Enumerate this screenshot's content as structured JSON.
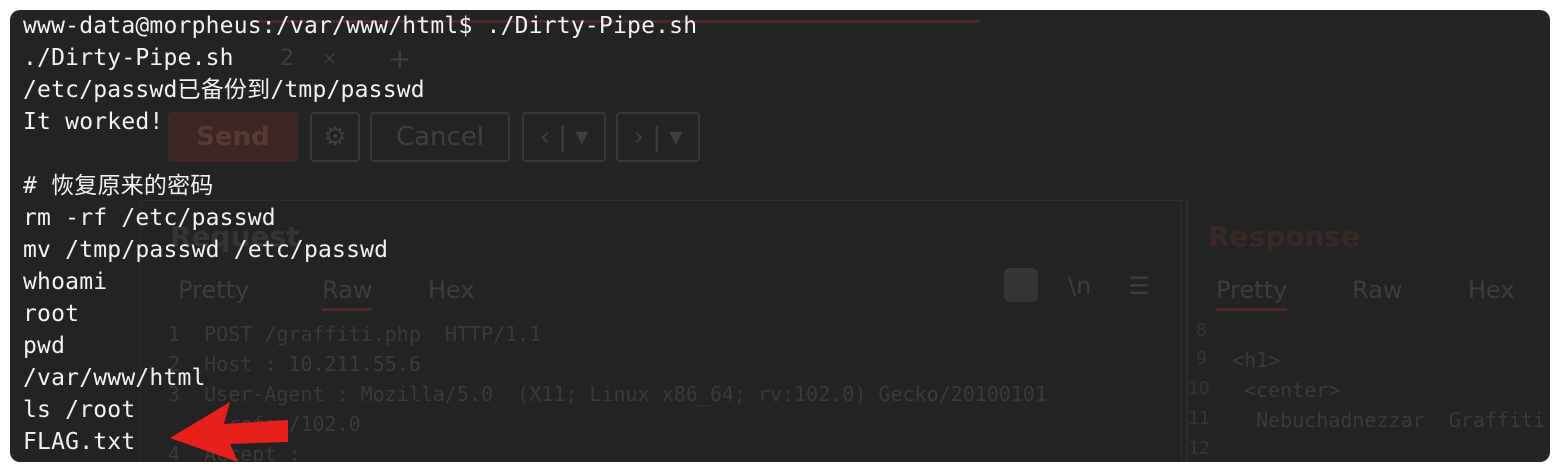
{
  "terminal": {
    "lines": [
      "www-data@morpheus:/var/www/html$ ./Dirty-Pipe.sh",
      "./Dirty-Pipe.sh",
      "/etc/passwd已备份到/tmp/passwd",
      "It worked!",
      "",
      "# 恢复原来的密码",
      "rm -rf /etc/passwd",
      "mv /tmp/passwd /etc/passwd",
      "whoami",
      "root",
      "pwd",
      "/var/www/html",
      "ls /root",
      "FLAG.txt"
    ]
  },
  "background_app": {
    "tab_number": "2",
    "tab_close": "×",
    "tab_add": "+",
    "send_label": "Send",
    "cancel_label": "Cancel",
    "request_title": "Request",
    "response_title": "Response",
    "request_tabs": [
      "Pretty",
      "Raw",
      "Hex"
    ],
    "response_tabs": [
      "Pretty",
      "Raw",
      "Hex"
    ],
    "newline_toggle": "\\n",
    "menu_glyph": "☰",
    "request_lines": [
      "1  POST /graffiti.php  HTTP/1.1",
      "2  Host : 10.211.55.6",
      "3  User-Agent : Mozilla/5.0  (X11; Linux x86_64; rv:102.0) Gecko/20100101",
      "   Firefox/102.0",
      "4  Accept :"
    ],
    "response_line_numbers": [
      "8",
      "9",
      "10",
      "11",
      "12"
    ],
    "response_lines": [
      "",
      "<h1>",
      " <center>",
      "  Nebuchadnezzar  Graffiti",
      ""
    ]
  },
  "colors": {
    "terminal_bg": "#232323",
    "text": "#f2f2f2",
    "arrow": "#e8201c"
  }
}
